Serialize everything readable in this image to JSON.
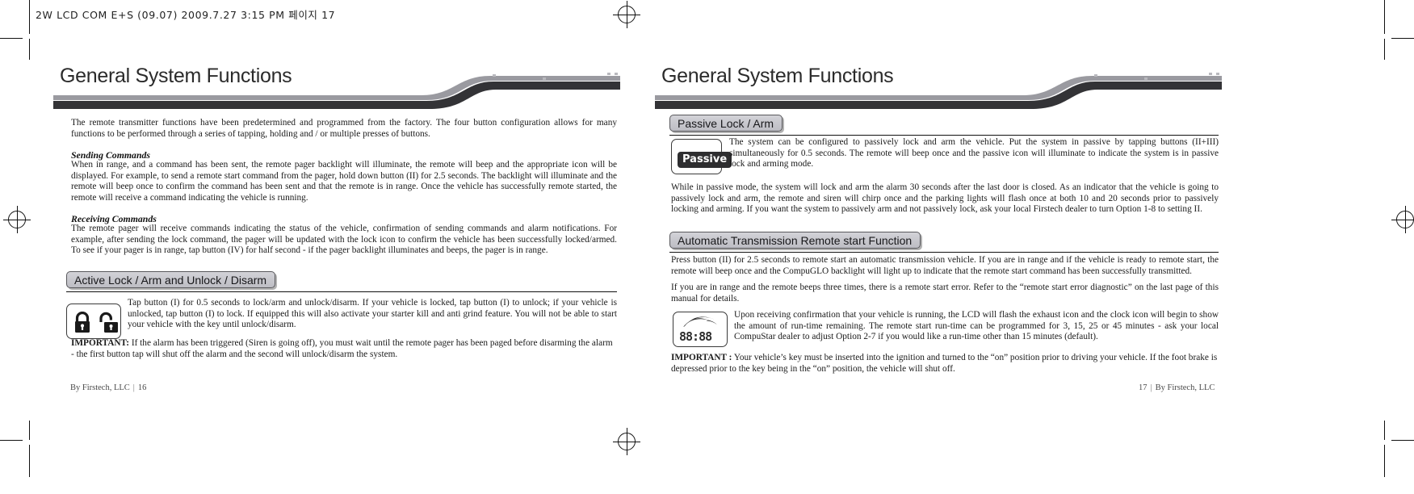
{
  "slug": {
    "text": "2W LCD COM E+S (09.07)  2009.7.27 3:15 PM 페이지 17"
  },
  "left_page": {
    "banner_title": "General System Functions",
    "intro": "The remote transmitter functions have been predetermined and programmed from the factory. The four button configuration allows for many functions to be performed through a series of tapping, holding and / or multiple presses of buttons.",
    "sending_heading": "Sending Commands",
    "sending_body": "When in range, and a command has been sent, the remote pager backlight will illuminate, the remote will beep and the appropriate icon will be displayed. For example, to send a remote start command from the pager, hold down button (II) for 2.5 seconds. The backlight will illuminate and the remote will beep once to confirm the command has been sent and that the remote is in range. Once the vehicle has successfully remote started, the remote will receive a command indicating the vehicle is running.",
    "receiving_heading": "Receiving Commands",
    "receiving_body": "The remote pager will receive commands indicating the status of the vehicle, confirmation of sending commands and alarm notifications. For example, after sending the lock command, the pager will be updated with the lock icon to confirm the vehicle has been successfully locked/armed. To see if your pager is in range, tap button (IV) for half second - if the pager backlight illuminates and beeps, the pager is in range.",
    "section_chip": "Active Lock / Arm and Unlock / Disarm",
    "active_lock_body": "Tap button (I) for 0.5 seconds to lock/arm and unlock/disarm. If your vehicle is locked, tap button (I) to unlock; if your vehicle is unlocked, tap button (I) to lock. If equipped this will also activate your starter kill and anti grind feature. You will not be able to start your vehicle with the key until unlock/disarm.",
    "important_label": "IMPORTANT:",
    "important_body": "If the alarm has been triggered (Siren is going off), you must wait until the remote pager has been paged before disarming the alarm - the first button tap will shut off the alarm and the second will unlock/disarm the system.",
    "icons": {
      "locked": "padlock-closed-icon",
      "unlocked": "padlock-open-icon"
    },
    "footer_credit": "By Firstech, LLC",
    "footer_separator": "|",
    "footer_page": "16"
  },
  "right_page": {
    "banner_title": "General System Functions",
    "passive_chip": "Passive Lock / Arm",
    "passive_badge": "Passive",
    "passive_body_1": "The system can be configured to passively lock and arm the vehicle. Put the system in passive by tapping buttons (II+III) simultaneously for 0.5 seconds. The remote will beep once and the passive icon will illuminate to indicate the system is in passive lock and arming mode.",
    "passive_body_2": "While in passive mode, the system will lock and arm the alarm 30 seconds after the last door is closed.  As an indicator that the vehicle is going to passively lock and arm, the remote and siren will chirp once and the parking lights will flash once at both 10 and 20 seconds prior to passively locking and arming. If you want the system to passively arm and not passively lock, ask your local Firstech dealer to turn Option 1-8 to setting II.",
    "auto_chip": "Automatic Transmission Remote start Function",
    "auto_body_1": "Press button (II) for 2.5 seconds to remote start an automatic transmission vehicle. If you are in range and if the vehicle is ready to remote start, the remote will beep once and the CompuGLO backlight will light up to indicate that the remote start command has been successfully transmitted.",
    "auto_body_2": "If you are in range and the remote beeps three times, there is a remote start error. Refer to the  “remote start error diagnostic” on the last page of this manual for details.",
    "runtime_body": "Upon receiving confirmation that your vehicle is running, the LCD will flash the exhaust icon and the clock icon will begin to show the amount of run-time remaining. The remote start run-time can be programmed for 3, 15, 25 or 45 minutes - ask your local CompuStar dealer to adjust Option 2-7 if you would like a run-time other than 15 minutes (default).",
    "important_label": "IMPORTANT :",
    "important_body": "Your vehicle’s key must be inserted into the ignition and turned to the “on” position prior to driving your vehicle. If the foot brake is depressed prior to the key being in the “on” position, the vehicle will shut off.",
    "icons": {
      "exhaust": "exhaust-smoke-icon",
      "clock": "segment-clock-icon"
    },
    "clock_display": "88:88",
    "footer_page": "17",
    "footer_separator": "|",
    "footer_credit": "By Firstech, LLC"
  },
  "colors": {
    "chip_fill": "#c8c8ce",
    "chip_border": "#58585c",
    "banner_dark": "#333336",
    "banner_mid": "#9a9aa0",
    "text": "#1a1a1a"
  }
}
